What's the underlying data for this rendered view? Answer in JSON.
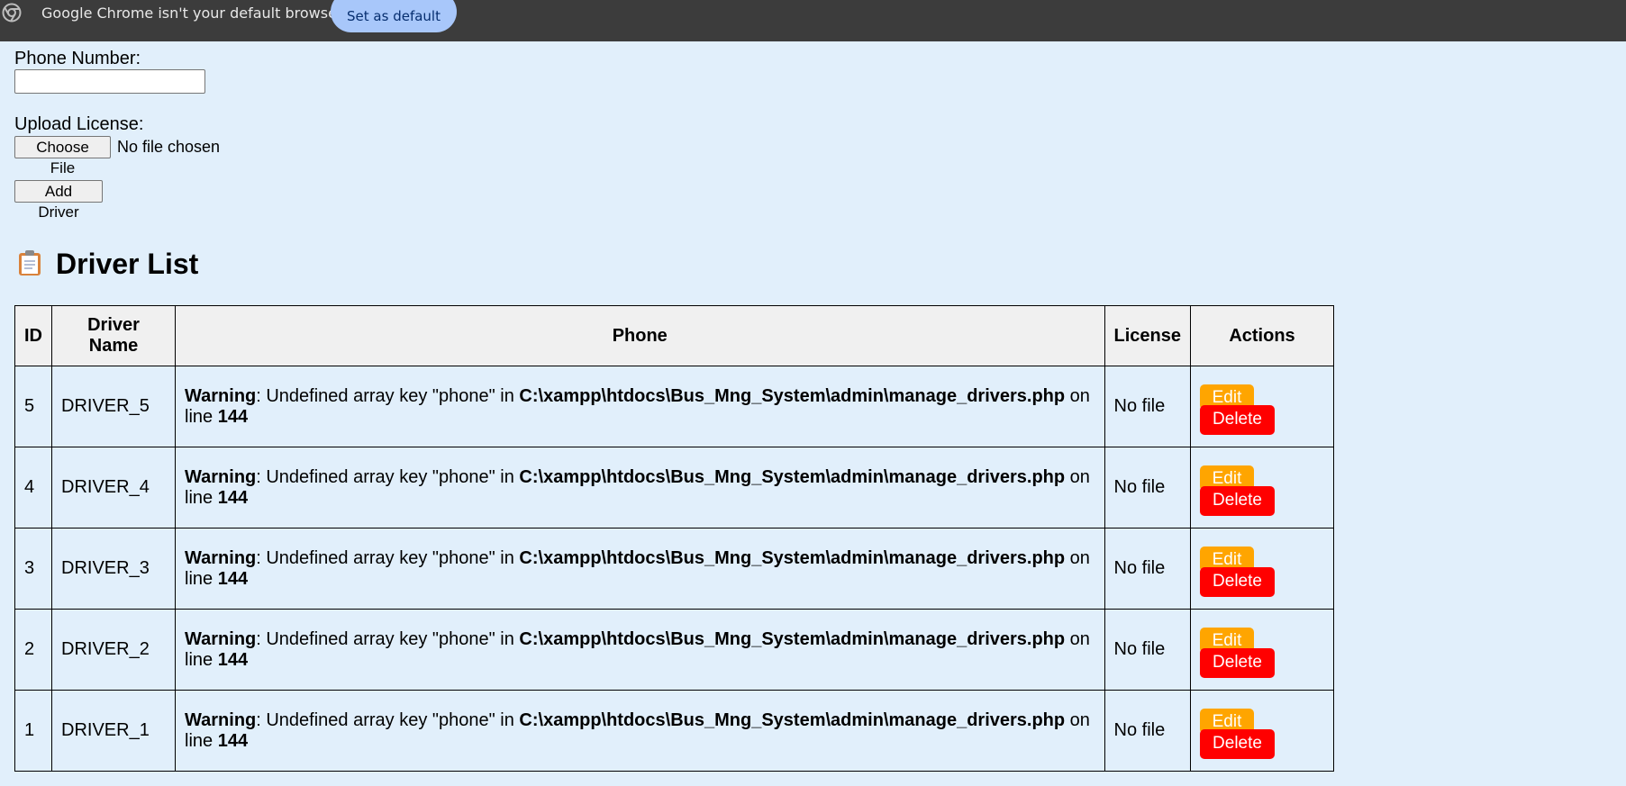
{
  "infobar": {
    "message": "Google Chrome isn't your default browser",
    "set_default_label": "Set as default"
  },
  "form": {
    "phone_label": "Phone Number:",
    "phone_value": "",
    "license_label": "Upload License:",
    "choose_file_label": "Choose File",
    "no_file_text": "No file chosen",
    "add_driver_label": "Add Driver"
  },
  "section": {
    "title": "Driver List",
    "icon": "clipboard-icon"
  },
  "table": {
    "headers": [
      "ID",
      "Driver Name",
      "Phone",
      "License",
      "Actions"
    ],
    "rows": [
      {
        "id": "5",
        "name": "DRIVER_5",
        "warn_label": "Warning",
        "warn_text": ": Undefined array key \"phone\" in ",
        "warn_path": "C:\\xampp\\htdocs\\Bus_Mng_System\\admin\\manage_drivers.php",
        "warn_on": " on line ",
        "warn_line": "144",
        "license": "No file",
        "edit": "Edit",
        "delete": "Delete"
      },
      {
        "id": "4",
        "name": "DRIVER_4",
        "warn_label": "Warning",
        "warn_text": ": Undefined array key \"phone\" in ",
        "warn_path": "C:\\xampp\\htdocs\\Bus_Mng_System\\admin\\manage_drivers.php",
        "warn_on": " on line ",
        "warn_line": "144",
        "license": "No file",
        "edit": "Edit",
        "delete": "Delete"
      },
      {
        "id": "3",
        "name": "DRIVER_3",
        "warn_label": "Warning",
        "warn_text": ": Undefined array key \"phone\" in ",
        "warn_path": "C:\\xampp\\htdocs\\Bus_Mng_System\\admin\\manage_drivers.php",
        "warn_on": " on line ",
        "warn_line": "144",
        "license": "No file",
        "edit": "Edit",
        "delete": "Delete"
      },
      {
        "id": "2",
        "name": "DRIVER_2",
        "warn_label": "Warning",
        "warn_text": ": Undefined array key \"phone\" in ",
        "warn_path": "C:\\xampp\\htdocs\\Bus_Mng_System\\admin\\manage_drivers.php",
        "warn_on": " on line ",
        "warn_line": "144",
        "license": "No file",
        "edit": "Edit",
        "delete": "Delete"
      },
      {
        "id": "1",
        "name": "DRIVER_1",
        "warn_label": "Warning",
        "warn_text": ": Undefined array key \"phone\" in ",
        "warn_path": "C:\\xampp\\htdocs\\Bus_Mng_System\\admin\\manage_drivers.php",
        "warn_on": " on line ",
        "warn_line": "144",
        "license": "No file",
        "edit": "Edit",
        "delete": "Delete"
      }
    ]
  },
  "colors": {
    "page_bg": "#e1effb",
    "infobar_bg": "#3c3c3c",
    "set_default_bg": "#a8c7fa",
    "edit_bg": "#ffa500",
    "delete_bg": "#ff0000",
    "header_bg": "#f0f0f0"
  }
}
